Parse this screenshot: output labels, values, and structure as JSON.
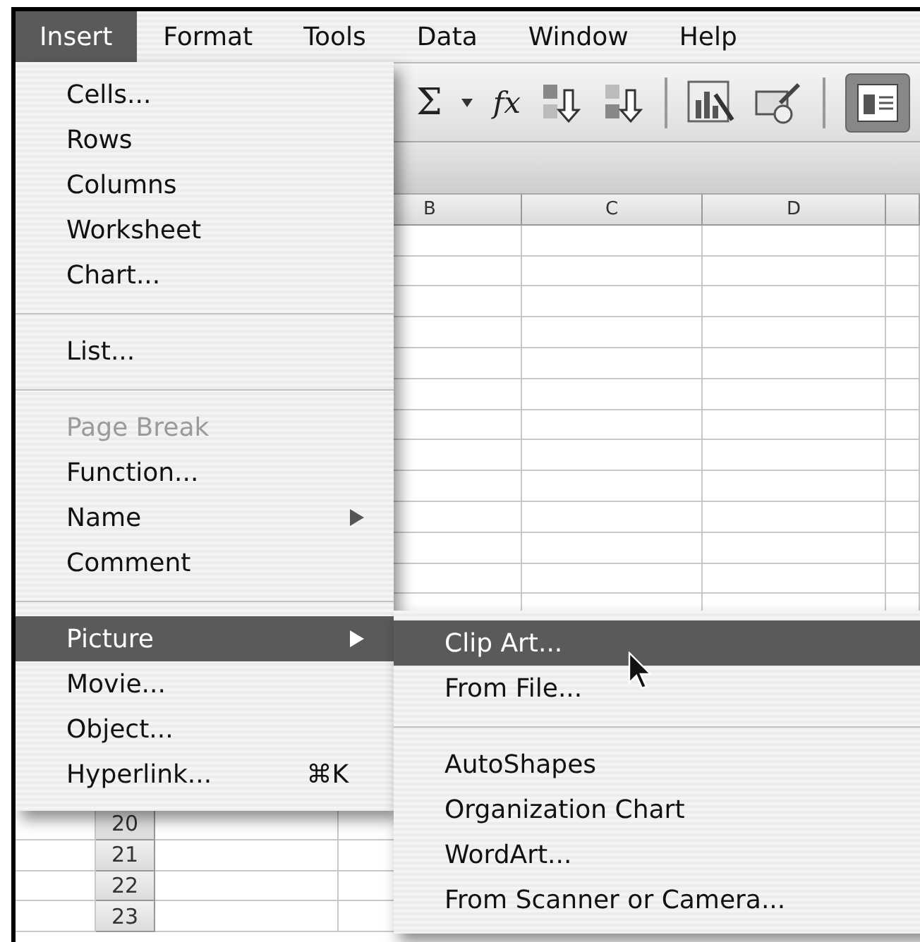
{
  "menu_bar": [
    {
      "label": "Insert",
      "selected": true
    },
    {
      "label": "Format",
      "selected": false
    },
    {
      "label": "Tools",
      "selected": false
    },
    {
      "label": "Data",
      "selected": false
    },
    {
      "label": "Window",
      "selected": false
    },
    {
      "label": "Help",
      "selected": false
    }
  ],
  "toolbar": {
    "sum_symbol": "Σ",
    "function_symbol": "fx",
    "text_box_pressed": true
  },
  "sheet": {
    "columns": [
      {
        "label": "B"
      },
      {
        "label": "C"
      },
      {
        "label": "D"
      }
    ],
    "row_numbers": [
      "20",
      "21",
      "22",
      "23"
    ]
  },
  "insert_menu": [
    {
      "kind": "item",
      "label": "Cells...",
      "disabled": false,
      "selected": false
    },
    {
      "kind": "item",
      "label": "Rows",
      "disabled": false,
      "selected": false
    },
    {
      "kind": "item",
      "label": "Columns",
      "disabled": false,
      "selected": false
    },
    {
      "kind": "item",
      "label": "Worksheet",
      "disabled": false,
      "selected": false
    },
    {
      "kind": "item",
      "label": "Chart...",
      "disabled": false,
      "selected": false
    },
    {
      "kind": "separator"
    },
    {
      "kind": "item",
      "label": "List...",
      "disabled": false,
      "selected": false
    },
    {
      "kind": "separator"
    },
    {
      "kind": "item",
      "label": "Page Break",
      "disabled": true,
      "selected": false
    },
    {
      "kind": "item",
      "label": "Function...",
      "disabled": false,
      "selected": false
    },
    {
      "kind": "submenu",
      "label": "Name",
      "disabled": false,
      "selected": false
    },
    {
      "kind": "item",
      "label": "Comment",
      "disabled": false,
      "selected": false
    },
    {
      "kind": "separator"
    },
    {
      "kind": "submenu",
      "label": "Picture",
      "disabled": false,
      "selected": true
    },
    {
      "kind": "item",
      "label": "Movie...",
      "disabled": false,
      "selected": false
    },
    {
      "kind": "item",
      "label": "Object...",
      "disabled": false,
      "selected": false
    },
    {
      "kind": "item",
      "label": "Hyperlink...",
      "disabled": false,
      "selected": false,
      "shortcut": "⌘K"
    }
  ],
  "picture_submenu": [
    {
      "kind": "item",
      "label": "Clip Art...",
      "selected": true
    },
    {
      "kind": "item",
      "label": "From File...",
      "selected": false
    },
    {
      "kind": "separator"
    },
    {
      "kind": "item",
      "label": "AutoShapes",
      "selected": false
    },
    {
      "kind": "item",
      "label": "Organization Chart",
      "selected": false
    },
    {
      "kind": "item",
      "label": "WordArt...",
      "selected": false
    },
    {
      "kind": "item",
      "label": "From Scanner or Camera...",
      "selected": false
    }
  ]
}
